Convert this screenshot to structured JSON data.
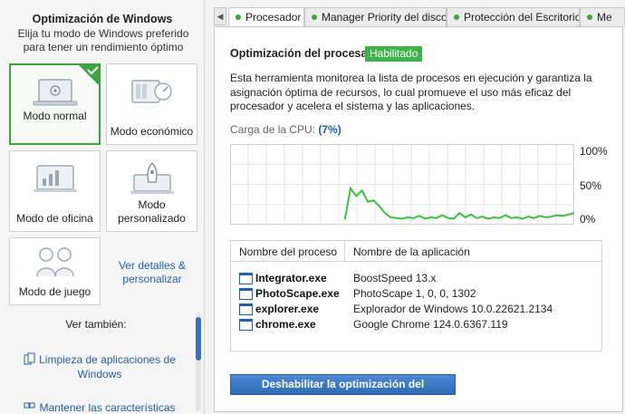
{
  "sidebar": {
    "title": "Optimización de Windows",
    "subtitle": "Elija tu modo de Windows preferido para tener un rendimiento óptimo",
    "modes": [
      {
        "label": "Modo normal",
        "selected": true
      },
      {
        "label": "Modo económico",
        "selected": false
      },
      {
        "label": "Modo de oficina",
        "selected": false
      },
      {
        "label": "Modo personalizado",
        "selected": false
      },
      {
        "label": "Modo de juego",
        "selected": false
      }
    ],
    "details_link": "Ver detalles & personalizar",
    "see_also": "Ver también:",
    "links": [
      "Limpieza de aplicaciones de Windows",
      "Mantener las características de"
    ]
  },
  "tabs": [
    {
      "label": "Procesador",
      "active": true
    },
    {
      "label": "Manager Priority del disco",
      "active": false
    },
    {
      "label": "Protección del Escritorio",
      "active": false
    },
    {
      "label": "Me",
      "active": false
    }
  ],
  "main": {
    "title": "Optimización del procesador",
    "status": "Habilitado",
    "description": "Esta herramienta monitorea la lista de procesos en ejecución y garantiza la asignación óptima de recursos, lo cual promueve el uso más eficaz del procesador y acelera el sistema y las aplicaciones.",
    "cpu_label": "Carga de la CPU:",
    "cpu_value": "(7%)",
    "axis_labels": [
      "100%",
      "50%",
      "0%"
    ],
    "table": {
      "headers": [
        "Nombre del proceso",
        "Nombre de la aplicación"
      ],
      "rows": [
        {
          "process": "Integrator.exe",
          "app": "BoostSpeed 13.x"
        },
        {
          "process": "PhotoScape.exe",
          "app": "PhotoScape 1, 0, 0, 1302"
        },
        {
          "process": "explorer.exe",
          "app": "Explorador de Windows 10.0.22621.2134"
        },
        {
          "process": "chrome.exe",
          "app": "Google Chrome 124.0.6367.119"
        }
      ]
    },
    "disable_button": "Deshabilitar la optimización del procesador"
  },
  "colors": {
    "accent": "#3fa33f",
    "link": "#1f5fb0",
    "button": "#2f6cb8"
  },
  "chart_data": {
    "type": "line",
    "ylim": [
      0,
      100
    ],
    "grid": true,
    "series": [
      {
        "x": [
          0,
          1,
          2,
          3,
          4,
          5,
          6,
          7,
          8,
          9,
          10,
          11,
          12,
          13,
          14,
          15,
          16,
          17,
          18,
          19,
          20,
          21,
          22,
          23,
          24,
          25,
          26,
          27,
          28,
          29,
          30,
          31,
          32,
          33,
          34,
          35,
          36,
          37,
          38,
          39,
          40,
          41,
          42,
          43,
          44,
          45,
          46,
          47,
          48,
          49,
          50,
          51,
          52,
          53,
          54,
          55,
          56,
          57,
          58,
          59,
          60
        ],
        "values": [
          null,
          null,
          null,
          null,
          null,
          null,
          null,
          null,
          null,
          null,
          null,
          null,
          null,
          null,
          null,
          null,
          null,
          null,
          null,
          null,
          1,
          45,
          34,
          42,
          26,
          28,
          20,
          10,
          4,
          3,
          2,
          4,
          3,
          6,
          2,
          4,
          3,
          7,
          3,
          2,
          10,
          4,
          8,
          3,
          5,
          2,
          4,
          3,
          7,
          3,
          4,
          2,
          5,
          3,
          6,
          4,
          5,
          7,
          6,
          8,
          10
        ]
      }
    ]
  }
}
